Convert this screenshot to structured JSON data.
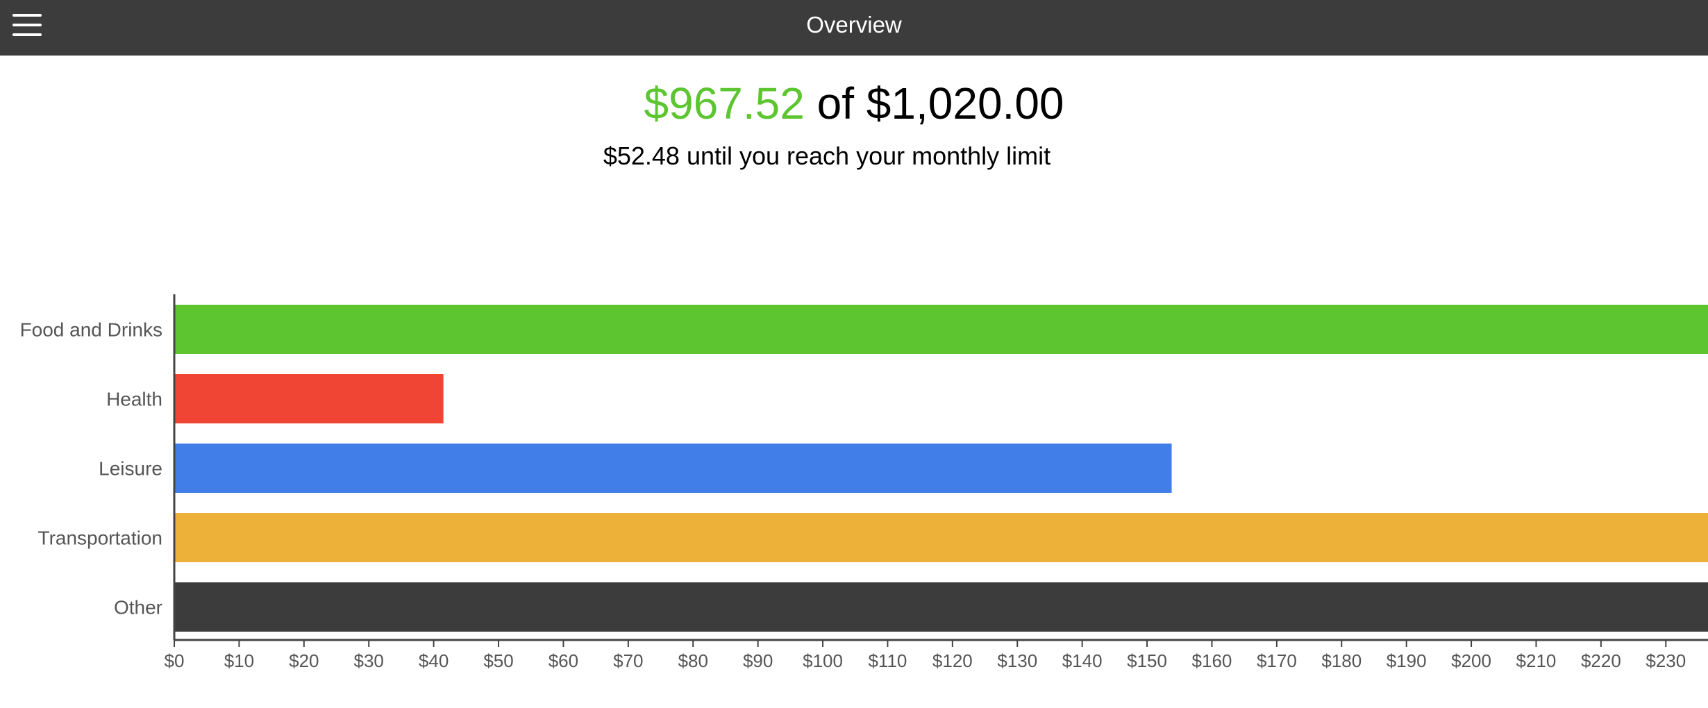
{
  "header": {
    "title": "Overview",
    "menu_icon": "hamburger-menu-icon"
  },
  "summary": {
    "spent": "$967.52",
    "of": "of",
    "limit": "$1,020.00",
    "remaining_text": "$52.48 until you reach your monthly limit",
    "spent_color": "#5cc530"
  },
  "chart_data": {
    "type": "bar",
    "orientation": "horizontal",
    "categories": [
      "Food and Drinks",
      "Health",
      "Leisure",
      "Transportation",
      "Other"
    ],
    "values": [
      240,
      41.5,
      153.8,
      240,
      240
    ],
    "colors": [
      "#5cc530",
      "#f04535",
      "#427ee8",
      "#edb038",
      "#3c3c3c"
    ],
    "x_ticks": [
      "$0",
      "$10",
      "$20",
      "$30",
      "$40",
      "$50",
      "$60",
      "$70",
      "$80",
      "$90",
      "$100",
      "$110",
      "$120",
      "$130",
      "$140",
      "$150",
      "$160",
      "$170",
      "$180",
      "$190",
      "$200",
      "$210",
      "$220",
      "$230"
    ],
    "xlim": [
      0,
      236.5
    ],
    "grid": false,
    "legend": "none"
  }
}
